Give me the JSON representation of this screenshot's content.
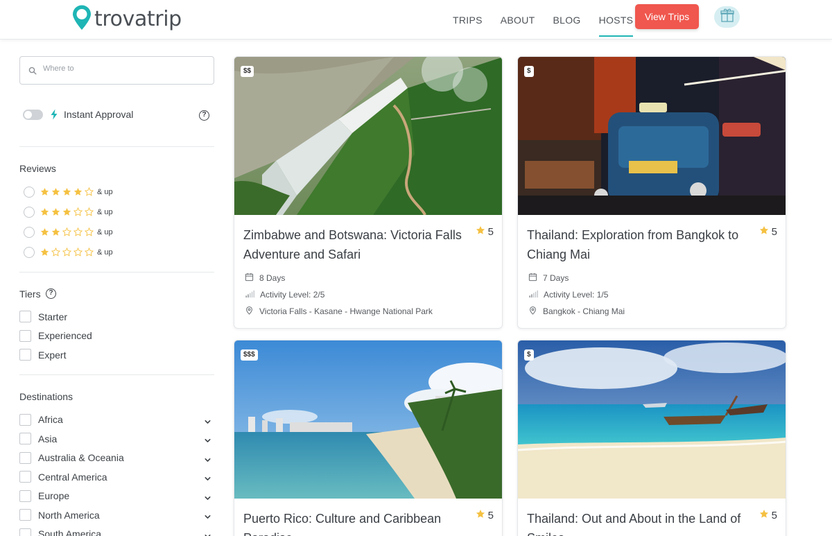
{
  "brand": {
    "name": "trovatrip",
    "accent": "#1fb5b5",
    "cta_color": "#f0574e"
  },
  "nav": {
    "links": [
      {
        "label": "TRIPS",
        "active": false
      },
      {
        "label": "ABOUT",
        "active": false
      },
      {
        "label": "BLOG",
        "active": false
      },
      {
        "label": "HOSTS",
        "active": true
      }
    ],
    "cta": "View Trips",
    "gift_icon": "gift-icon"
  },
  "filters": {
    "search": {
      "placeholder": "Where to",
      "value": ""
    },
    "instant_approval": {
      "label": "Instant Approval",
      "enabled": false
    },
    "reviews": {
      "title": "Reviews",
      "options": [
        {
          "stars": 4,
          "label": "& up"
        },
        {
          "stars": 3,
          "label": "& up"
        },
        {
          "stars": 2,
          "label": "& up"
        },
        {
          "stars": 1,
          "label": "& up"
        }
      ]
    },
    "tiers": {
      "title": "Tiers",
      "options": [
        "Starter",
        "Experienced",
        "Expert"
      ]
    },
    "destinations": {
      "title": "Destinations",
      "options": [
        "Africa",
        "Asia",
        "Australia & Oceania",
        "Central America",
        "Europe",
        "North America",
        "South America"
      ]
    }
  },
  "trips": [
    {
      "price": "$$",
      "title": "Zimbabwe and Botswana: Victoria Falls Adventure and Safari",
      "rating": "5",
      "duration": "8 Days",
      "activity": "Activity Level: 2/5",
      "route": "Victoria Falls - Kasane - Hwange National Park"
    },
    {
      "price": "$",
      "title": "Thailand: Exploration from Bangkok to Chiang Mai",
      "rating": "5",
      "duration": "7 Days",
      "activity": "Activity Level: 1/5",
      "route": "Bangkok - Chiang Mai"
    },
    {
      "price": "$$$",
      "title": "Puerto Rico: Culture and Caribbean Paradise",
      "rating": "5"
    },
    {
      "price": "$",
      "title": "Thailand: Out and About in the Land of Smiles",
      "rating": "5"
    }
  ]
}
